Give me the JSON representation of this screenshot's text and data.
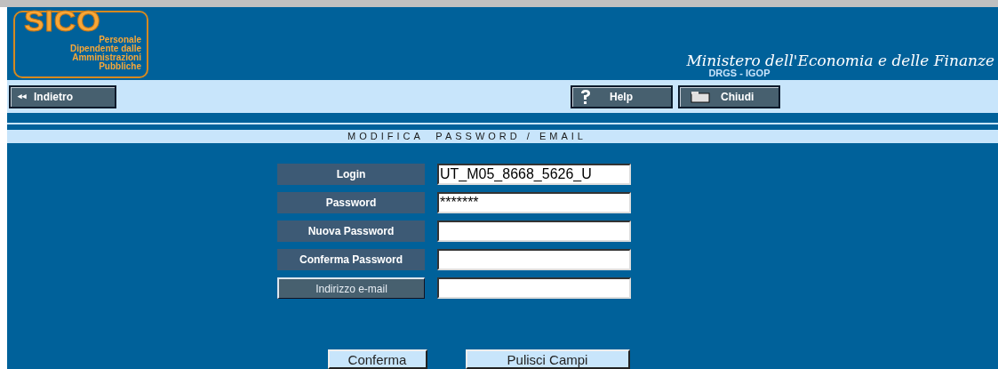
{
  "logo": {
    "title": "SICO",
    "lines": [
      "Personale",
      "Dipendente dalle",
      "Amministrazioni",
      "Pubbliche"
    ]
  },
  "header": {
    "ministry": "Ministero dell'Economia e delle Finanze",
    "department": "DRGS - IGOP"
  },
  "toolbar": {
    "back": "Indietro",
    "back_glyph": "◂◂",
    "help": "Help",
    "close": "Chiudi"
  },
  "page_title": "MODIFICA  PASSWORD / EMAIL",
  "fields": [
    {
      "label": "Login",
      "kind": "label",
      "value": "UT_M05_8668_5626_U"
    },
    {
      "label": "Password",
      "kind": "label",
      "value": "*******"
    },
    {
      "label": "Nuova Password",
      "kind": "label"
    },
    {
      "label": "Conferma Password",
      "kind": "label"
    },
    {
      "label": "Indirizzo e-mail",
      "kind": "button"
    }
  ],
  "buttons": [
    "Conferma",
    "Pulisci Campi"
  ]
}
